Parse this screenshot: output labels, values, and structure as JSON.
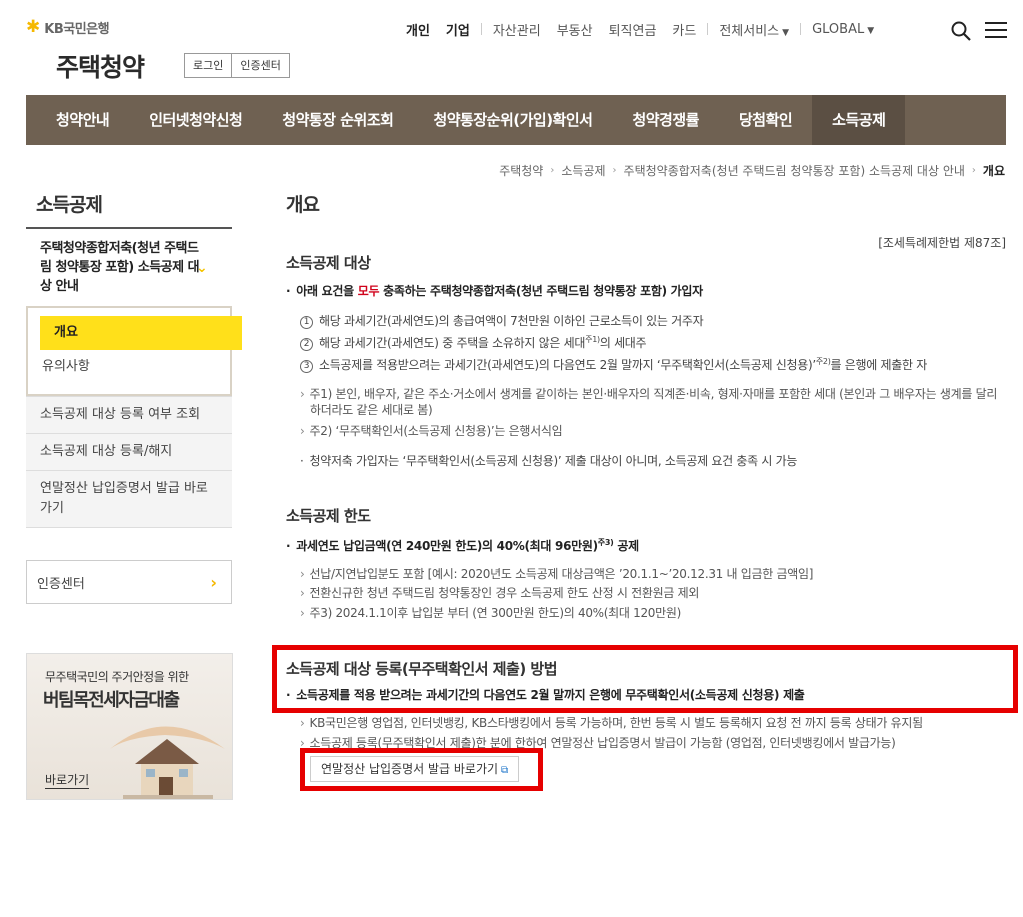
{
  "header": {
    "logo_text": "KB국민은행",
    "site_title": "주택청약",
    "login": "로그인",
    "cert_center": "인증센터",
    "topnav": [
      "개인",
      "기업",
      "자산관리",
      "부동산",
      "퇴직연금",
      "카드",
      "전체서비스",
      "GLOBAL"
    ]
  },
  "gnb": [
    "청약안내",
    "인터넷청약신청",
    "청약통장 순위조회",
    "청약통장순위(가입)확인서",
    "청약경쟁률",
    "당첨확인",
    "소득공제"
  ],
  "breadcrumb": [
    "주택청약",
    "소득공제",
    "주택청약종합저축(청년 주택드림 청약통장 포함) 소득공제 대상 안내",
    "개요"
  ],
  "lnb": {
    "title": "소득공제",
    "group": "주택청약종합저축(청년 주택드림 청약통장 포함) 소득공제 대상 안내",
    "subs": [
      "개요",
      "유의사항"
    ],
    "items": [
      "소득공제 대상 등록 여부 조회",
      "소득공제 대상 등록/해지",
      "연말정산 납입증명서 발급 바로가기"
    ],
    "cert": "인증센터"
  },
  "banner": {
    "line1": "무주택국민의 주거안정을 위한",
    "line2": "버팀목전세자금대출",
    "go": "바로가기"
  },
  "content": {
    "title": "개요",
    "law": "[조세특례제한법 제87조]",
    "s1": {
      "title": "소득공제 대상",
      "lead_a": "아래 요건을",
      "lead_red": "모두",
      "lead_b": "충족하는 주택청약종합저축(청년 주택드림 청약통장 포함) 가입자",
      "n1": "해당 과세기간(과세연도)의 총급여액이 7천만원 이하인 근로소득이 있는 거주자",
      "n2a": "해당 과세기간(과세연도) 중 주택을 소유하지 않은 세대",
      "n2sup": "주1)",
      "n2b": "의 세대주",
      "n3a": "소득공제를 적용받으려는 과세기간(과세연도)의 다음연도 2월 말까지 ‘무주택확인서(소득공제 신청용)’",
      "n3sup": "주2)",
      "n3b": "를 은행에 제출한 자",
      "note1": "주1) 본인, 배우자, 같은 주소·거소에서 생계를 같이하는 본인·배우자의 직계존·비속, 형제·자매를 포함한 세대 (본인과 그 배우자는 생계를 달리하더라도 같은 세대로 봄)",
      "note2": "주2) ‘무주택확인서(소득공제 신청용)’는 은행서식임",
      "bullet": "청약저축 가입자는 ‘무주택확인서(소득공제 신청용)’ 제출 대상이 아니며, 소득공제 요건 충족 시 가능"
    },
    "s2": {
      "title": "소득공제 한도",
      "lead": "과세연도 납입금액(연 240만원 한도)의 40%(최대 96만원)",
      "lead_sup": "주3)",
      "lead_b": "공제",
      "n1": "선납/지연납입분도 포함 [예시: 2020년도 소득공제 대상금액은 ’20.1.1~’20.12.31 내 입금한 금액임]",
      "n2": "전환신규한 청년 주택드림 청약통장인 경우 소득공제 한도 산정 시 전환원금 제외",
      "n3": "주3) 2024.1.1이후 납입분 부터 (연 300만원 한도)의 40%(최대 120만원)"
    },
    "s3": {
      "title": "소득공제 대상 등록(무주택확인서 제출) 방법",
      "lead": "소득공제를 적용 받으려는 과세기간의 다음연도 2월 말까지 은행에 무주택확인서(소득공제 신청용) 제출",
      "n1": "KB국민은행 영업점, 인터넷뱅킹, KB스타뱅킹에서 등록 가능하며, 한번 등록 시 별도 등록해지 요청 전 까지 등록 상태가 유지됨",
      "n2": "소득공제 등록(무주택확인서 제출)한 분에 한하여 연말정산 납입증명서 발급이 가능함 (영업점, 인터넷뱅킹에서 발급가능)",
      "button": "연말정산 납입증명서 발급 바로가기"
    }
  }
}
